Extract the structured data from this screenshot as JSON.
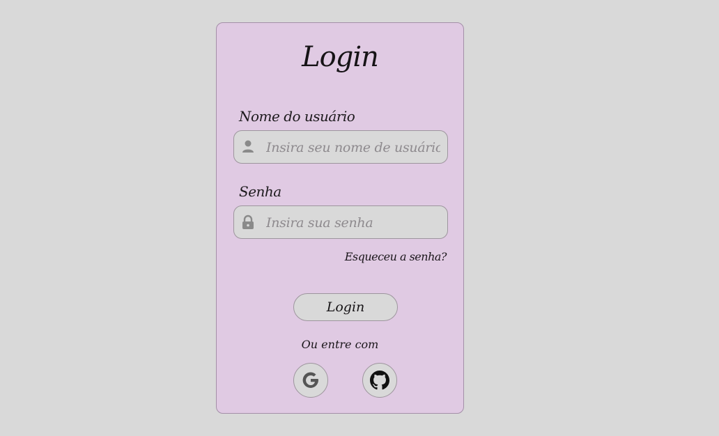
{
  "login_card": {
    "title": "Login",
    "username": {
      "label": "Nome do usuário",
      "placeholder": "Insira seu nome de usuário",
      "value": ""
    },
    "password": {
      "label": "Senha",
      "placeholder": "Insira sua senha",
      "value": ""
    },
    "forgot_password": "Esqueceu a senha?",
    "submit_label": "Login",
    "alt_login_text": "Ou entre com",
    "social": [
      {
        "icon": "google-icon"
      },
      {
        "icon": "github-icon"
      }
    ]
  },
  "colors": {
    "background": "#d9d9d9",
    "card": "#e0cae3",
    "input": "#d9d9d9",
    "text": "#161316",
    "placeholder": "#8e8a8e"
  }
}
